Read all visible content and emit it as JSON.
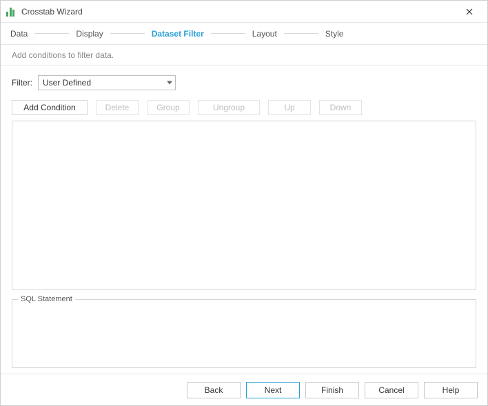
{
  "window": {
    "title": "Crosstab Wizard"
  },
  "steps": {
    "items": [
      {
        "label": "Data",
        "active": false
      },
      {
        "label": "Display",
        "active": false
      },
      {
        "label": "Dataset Filter",
        "active": true
      },
      {
        "label": "Layout",
        "active": false
      },
      {
        "label": "Style",
        "active": false
      }
    ]
  },
  "subheader": {
    "text": "Add conditions to filter data."
  },
  "filter": {
    "label": "Filter:",
    "selected": "User Defined"
  },
  "toolbar": {
    "add_condition": "Add Condition",
    "delete": "Delete",
    "group": "Group",
    "ungroup": "Ungroup",
    "up": "Up",
    "down": "Down"
  },
  "sql": {
    "legend": "SQL Statement"
  },
  "footer": {
    "back": "Back",
    "next": "Next",
    "finish": "Finish",
    "cancel": "Cancel",
    "help": "Help"
  }
}
